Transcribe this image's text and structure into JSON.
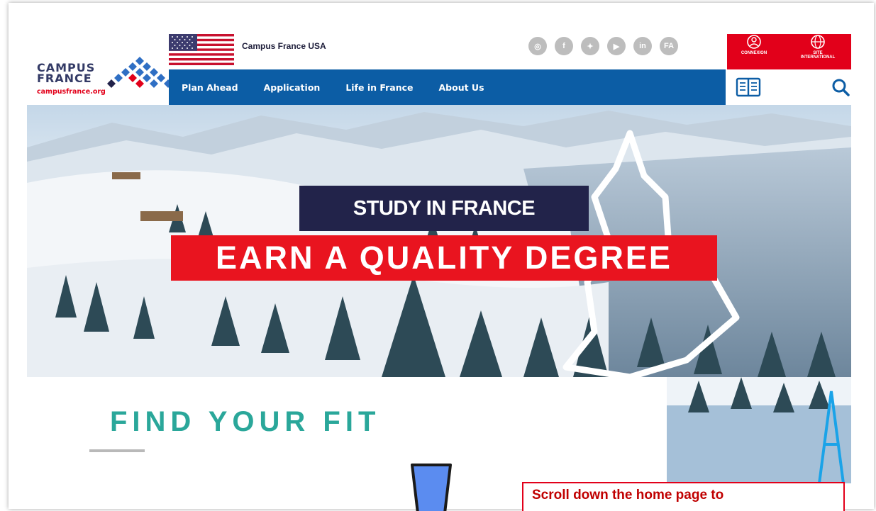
{
  "logo": {
    "line1": "CAMPUS",
    "line2": "FRANCE",
    "url": "campusfrance.org"
  },
  "topbar": {
    "country_label": "Campus France USA",
    "social": [
      {
        "name": "instagram-icon",
        "glyph": "◎"
      },
      {
        "name": "facebook-icon",
        "glyph": "f"
      },
      {
        "name": "twitter-icon",
        "glyph": "✦"
      },
      {
        "name": "youtube-icon",
        "glyph": "▶"
      },
      {
        "name": "linkedin-icon",
        "glyph": "in"
      },
      {
        "name": "fa-icon",
        "glyph": "FA"
      }
    ],
    "connexion_label": "CONNEXION",
    "site_label_1": "SITE",
    "site_label_2": "INTERNATIONAL"
  },
  "nav": {
    "items": [
      "Plan Ahead",
      "Application",
      "Life in France",
      "About Us"
    ]
  },
  "hero": {
    "tagline": "STUDY IN FRANCE",
    "headline": "EARN A QUALITY DEGREE"
  },
  "section": {
    "title": "FIND YOUR FIT"
  },
  "callout": {
    "text": "Scroll down the home page to"
  },
  "colors": {
    "brand_red": "#e2001a",
    "nav_blue": "#0c5da5",
    "navy": "#22234a",
    "teal": "#2aa79a",
    "arrow_blue": "#5b8cf0"
  }
}
